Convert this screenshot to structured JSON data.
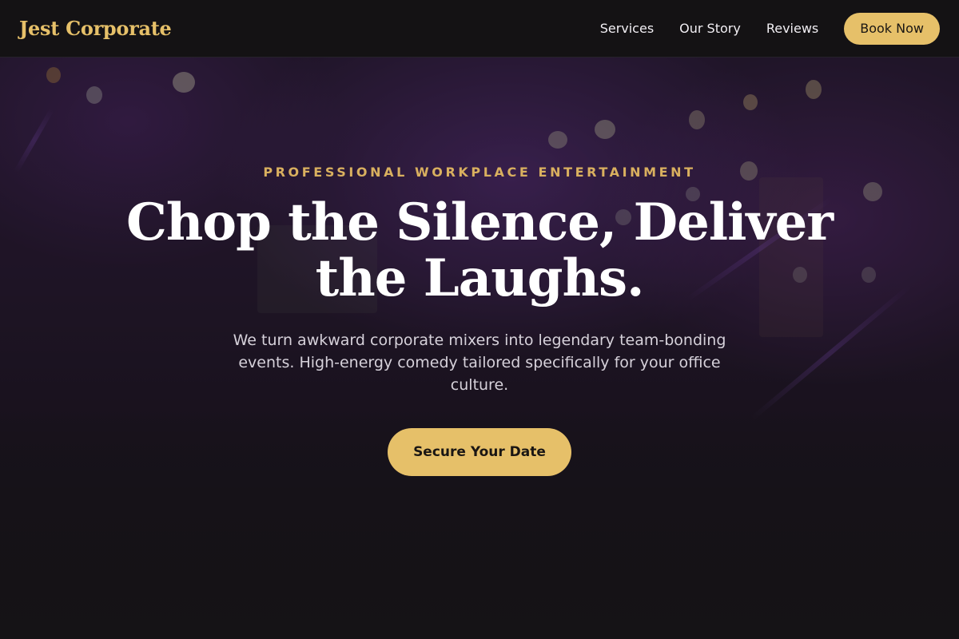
{
  "header": {
    "logo": "Jest Corporate",
    "nav": [
      {
        "label": "Services"
      },
      {
        "label": "Our Story"
      },
      {
        "label": "Reviews"
      }
    ],
    "cta_label": "Book Now"
  },
  "hero": {
    "eyebrow": "PROFESSIONAL WORKPLACE ENTERTAINMENT",
    "headline": "Chop the Silence, Deliver the Laughs.",
    "subtext": "We turn awkward corporate mixers into legendary team-bonding events. High-energy comedy tailored specifically for your office culture.",
    "cta_label": "Secure Your Date"
  },
  "colors": {
    "accent": "#e6c069",
    "header_bg": "#141214",
    "hero_tint": "#2b1c38"
  }
}
